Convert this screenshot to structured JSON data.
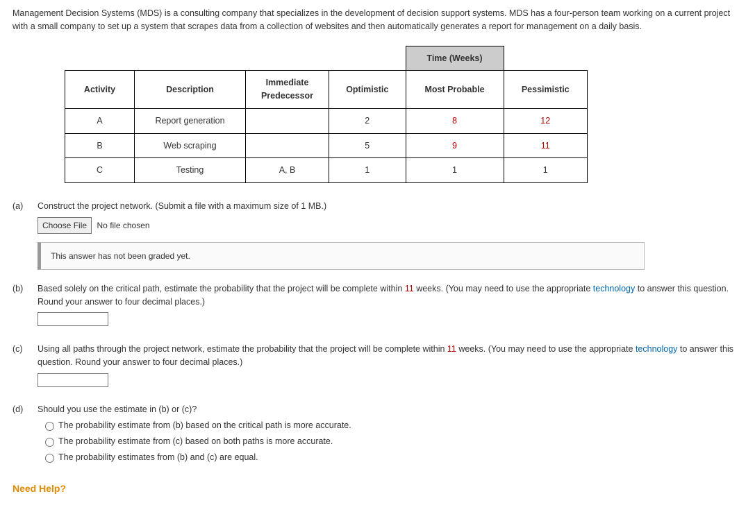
{
  "intro": "Management Decision Systems (MDS) is a consulting company that specializes in the development of decision support systems. MDS has a four-person team working on a current project with a small company to set up a system that scrapes data from a collection of websites and then automatically generates a report for management on a daily basis.",
  "table": {
    "time_header": "Time (Weeks)",
    "headers": {
      "activity": "Activity",
      "description": "Description",
      "predecessor": "Immediate Predecessor",
      "optimistic": "Optimistic",
      "most_probable": "Most Probable",
      "pessimistic": "Pessimistic"
    },
    "rows": [
      {
        "activity": "A",
        "description": "Report generation",
        "predecessor": "",
        "optimistic": "2",
        "most_probable": "8",
        "pessimistic": "12"
      },
      {
        "activity": "B",
        "description": "Web scraping",
        "predecessor": "",
        "optimistic": "5",
        "most_probable": "9",
        "pessimistic": "11"
      },
      {
        "activity": "C",
        "description": "Testing",
        "predecessor": "A, B",
        "optimistic": "1",
        "most_probable": "1",
        "pessimistic": "1"
      }
    ]
  },
  "parts": {
    "a": {
      "label": "(a)",
      "text": "Construct the project network. (Submit a file with a maximum size of 1 MB.)",
      "choose_file": "Choose File",
      "no_file": "No file chosen",
      "grade_msg": "This answer has not been graded yet."
    },
    "b": {
      "label": "(b)",
      "text_pre": "Based solely on the critical path, estimate the probability that the project will be complete within ",
      "weeks": "11",
      "text_mid": " weeks. (You may need to use the appropriate ",
      "link": "technology",
      "text_post": " to answer this question. Round your answer to four decimal places.)"
    },
    "c": {
      "label": "(c)",
      "text_pre": "Using all paths through the project network, estimate the probability that the project will be complete within ",
      "weeks": "11",
      "text_mid": " weeks. (You may need to use the appropriate ",
      "link": "technology",
      "text_post": " to answer this question. Round your answer to four decimal places.)"
    },
    "d": {
      "label": "(d)",
      "text": "Should you use the estimate in (b) or (c)?",
      "options": [
        "The probability estimate from (b) based on the critical path is more accurate.",
        "The probability estimate from (c) based on both paths is more accurate.",
        "The probability estimates from (b) and (c) are equal."
      ]
    }
  },
  "need_help": "Need Help?"
}
